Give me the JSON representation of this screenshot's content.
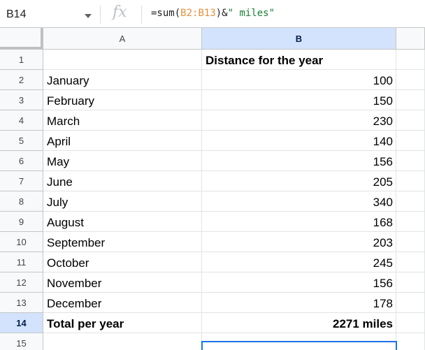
{
  "name_box": {
    "value": "B14"
  },
  "formula_bar": {
    "fx_label": "fx",
    "parts": {
      "prefix": "=sum(",
      "range": "B2:B13",
      "middle": ")&",
      "string": "\" miles\""
    }
  },
  "columns": [
    {
      "label": "A",
      "active": false
    },
    {
      "label": "B",
      "active": true
    },
    {
      "label": "",
      "active": false
    }
  ],
  "rows": [
    {
      "num": "1",
      "a": "",
      "b": "Distance for the year",
      "b_header": true
    },
    {
      "num": "2",
      "a": "January",
      "b": "100"
    },
    {
      "num": "3",
      "a": "February",
      "b": "150"
    },
    {
      "num": "4",
      "a": "March",
      "b": "230"
    },
    {
      "num": "5",
      "a": "April",
      "b": "140"
    },
    {
      "num": "6",
      "a": "May",
      "b": "156"
    },
    {
      "num": "7",
      "a": "June",
      "b": "205"
    },
    {
      "num": "8",
      "a": "July",
      "b": "340"
    },
    {
      "num": "9",
      "a": "August",
      "b": "168"
    },
    {
      "num": "10",
      "a": "September",
      "b": "203"
    },
    {
      "num": "11",
      "a": "October",
      "b": "245"
    },
    {
      "num": "12",
      "a": "November",
      "b": "156"
    },
    {
      "num": "13",
      "a": "December",
      "b": "178"
    },
    {
      "num": "14",
      "a": "Total per year",
      "b": "2271 miles",
      "bold": true,
      "active": true
    },
    {
      "num": "15",
      "a": "",
      "b": ""
    }
  ],
  "colors": {
    "selection": "#1a73e8",
    "active_header": "#d3e3fd",
    "formula_ref": "#e69138",
    "formula_string": "#188038"
  }
}
